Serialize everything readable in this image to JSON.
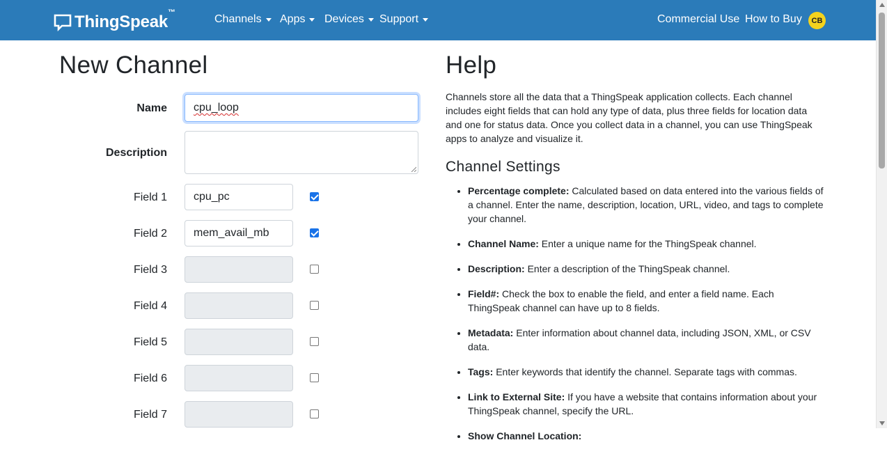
{
  "navbar": {
    "brand": "ThingSpeak",
    "brand_tm": "™",
    "menus": [
      {
        "label": "Channels"
      },
      {
        "label": "Apps"
      },
      {
        "label": "Devices"
      },
      {
        "label": "Support"
      }
    ],
    "commercial_use": "Commercial Use",
    "how_to_buy": "How to Buy",
    "avatar_initials": "CB"
  },
  "form": {
    "title": "New Channel",
    "name_label": "Name",
    "name_value": "cpu_loop",
    "description_label": "Description",
    "description_value": "",
    "fields": [
      {
        "label": "Field 1",
        "value": "cpu_pc",
        "checked": true
      },
      {
        "label": "Field 2",
        "value": "mem_avail_mb",
        "checked": true
      },
      {
        "label": "Field 3",
        "value": "",
        "checked": false
      },
      {
        "label": "Field 4",
        "value": "",
        "checked": false
      },
      {
        "label": "Field 5",
        "value": "",
        "checked": false
      },
      {
        "label": "Field 6",
        "value": "",
        "checked": false
      },
      {
        "label": "Field 7",
        "value": "",
        "checked": false
      }
    ]
  },
  "help": {
    "title": "Help",
    "intro": "Channels store all the data that a ThingSpeak application collects. Each channel includes eight fields that can hold any type of data, plus three fields for location data and one for status data. Once you collect data in a channel, you can use ThingSpeak apps to analyze and visualize it.",
    "settings_title": "Channel Settings",
    "items": [
      {
        "term": "Percentage complete:",
        "text": " Calculated based on data entered into the various fields of a channel. Enter the name, description, location, URL, video, and tags to complete your channel."
      },
      {
        "term": "Channel Name:",
        "text": " Enter a unique name for the ThingSpeak channel."
      },
      {
        "term": "Description:",
        "text": " Enter a description of the ThingSpeak channel."
      },
      {
        "term": "Field#:",
        "text": " Check the box to enable the field, and enter a field name. Each ThingSpeak channel can have up to 8 fields."
      },
      {
        "term": "Metadata:",
        "text": " Enter information about channel data, including JSON, XML, or CSV data."
      },
      {
        "term": "Tags:",
        "text": " Enter keywords that identify the channel. Separate tags with commas."
      },
      {
        "term": "Link to External Site:",
        "text": " If you have a website that contains information about your ThingSpeak channel, specify the URL."
      },
      {
        "term": "Show Channel Location:",
        "text": ""
      }
    ]
  },
  "colors": {
    "navbar_bg": "#2b7bb9",
    "avatar_bg": "#f4d31e",
    "checkbox_checked": "#1a73e8",
    "disabled_input_bg": "#e9ecef"
  },
  "icons": {
    "brand": "chat-bubble-icon",
    "dropdown": "caret-down-icon"
  }
}
